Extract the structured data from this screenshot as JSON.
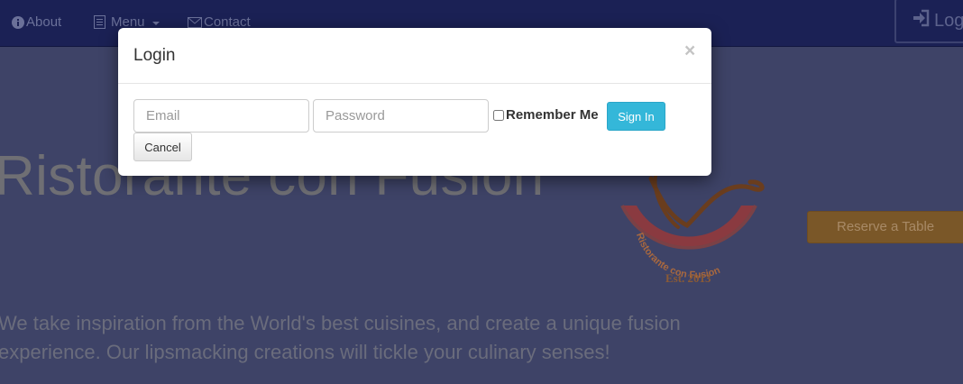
{
  "navbar": {
    "about_label": "About",
    "menu_label": "Menu",
    "contact_label": "Contact",
    "login_label": "Login"
  },
  "hero": {
    "title": "Ristorante con Fusion",
    "line1": "We take inspiration from the World's best cuisines, and create a unique fusion",
    "line2": "experience. Our lipsmacking creations will tickle your culinary senses!",
    "reserve_label": "Reserve a Table",
    "logo_text": "Ristorante con Fusion",
    "logo_est": "Est. 2013"
  },
  "modal": {
    "title": "Login",
    "close_symbol": "×",
    "email_placeholder": "Email",
    "password_placeholder": "Password",
    "remember_label": "Remember Me",
    "remember_checked": false,
    "signin_label": "Sign In",
    "cancel_label": "Cancel"
  },
  "colors": {
    "navbar": "#1b2155",
    "overlay_bg": "#3e4367",
    "signin_button": "#34b7d9",
    "reserve_button": "#7a5728"
  },
  "icons": {
    "about": "info-circle-icon",
    "menu": "list-alt-icon",
    "contact": "envelope-icon",
    "login": "log-in-icon",
    "close": "close-icon"
  }
}
